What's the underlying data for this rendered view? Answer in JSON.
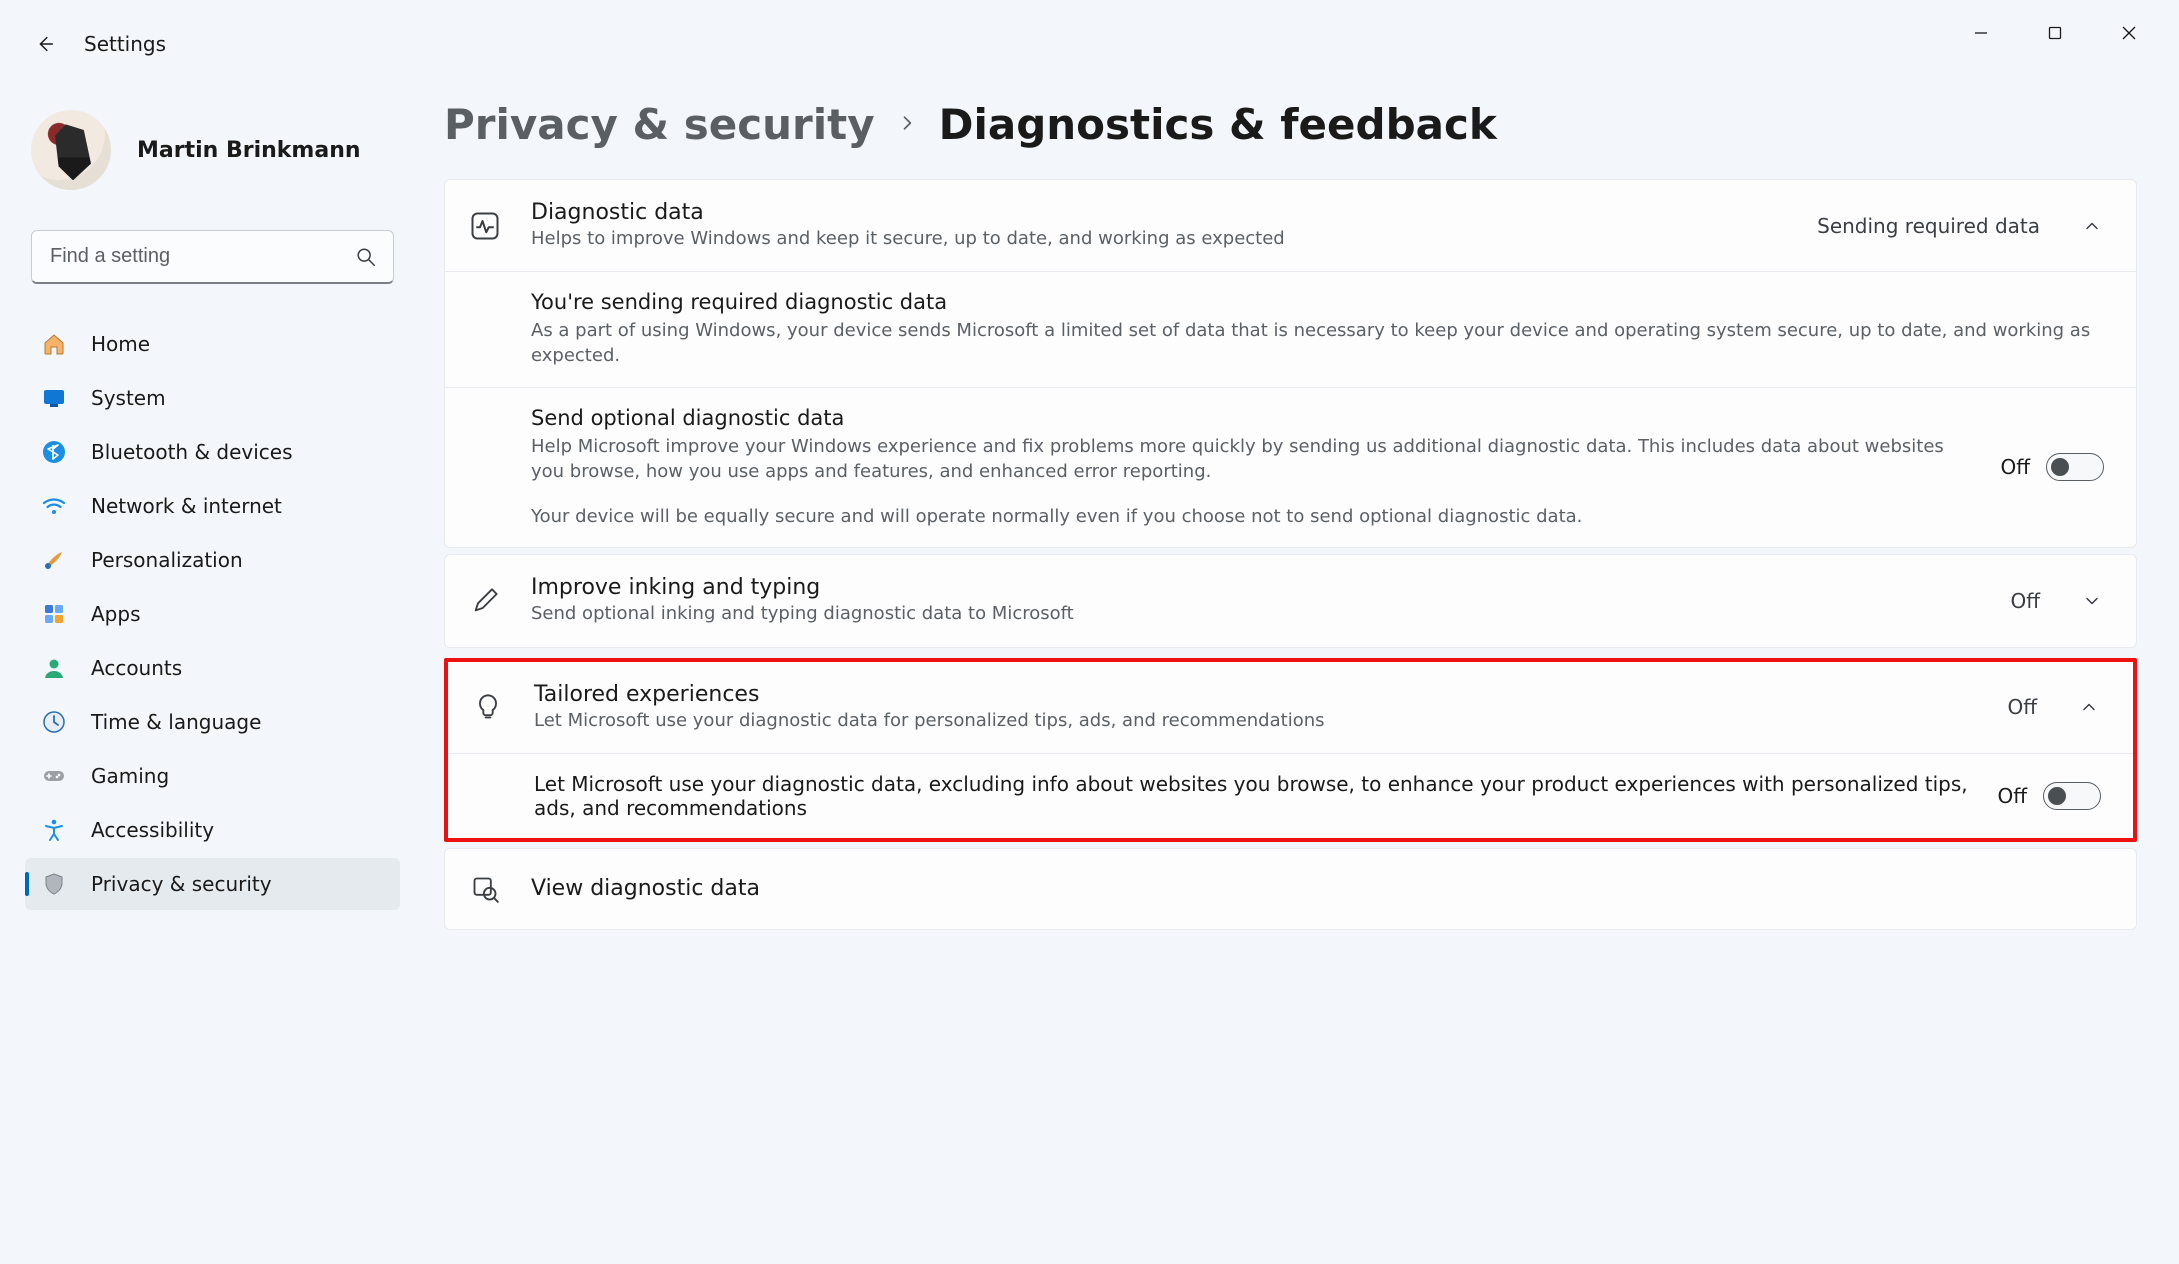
{
  "app_title": "Settings",
  "user_name": "Martin Brinkmann",
  "search": {
    "placeholder": "Find a setting"
  },
  "nav": {
    "items": [
      {
        "id": "home",
        "label": "Home"
      },
      {
        "id": "system",
        "label": "System"
      },
      {
        "id": "bluetooth",
        "label": "Bluetooth & devices"
      },
      {
        "id": "network",
        "label": "Network & internet"
      },
      {
        "id": "personalization",
        "label": "Personalization"
      },
      {
        "id": "apps",
        "label": "Apps"
      },
      {
        "id": "accounts",
        "label": "Accounts"
      },
      {
        "id": "time",
        "label": "Time & language"
      },
      {
        "id": "gaming",
        "label": "Gaming"
      },
      {
        "id": "accessibility",
        "label": "Accessibility"
      },
      {
        "id": "privacy",
        "label": "Privacy & security"
      }
    ]
  },
  "breadcrumb": {
    "parent": "Privacy & security",
    "current": "Diagnostics & feedback"
  },
  "sections": {
    "diag": {
      "title": "Diagnostic data",
      "sub": "Helps to improve Windows and keep it secure, up to date, and working as expected",
      "status": "Sending required data",
      "rows": [
        {
          "title": "You're sending required diagnostic data",
          "desc": "As a part of using Windows, your device sends Microsoft a limited set of data that is necessary to keep your device and operating system secure, up to date, and working as expected."
        },
        {
          "title": "Send optional diagnostic data",
          "desc": "Help Microsoft improve your Windows experience and fix problems more quickly by sending us additional diagnostic data. This includes data about websites you browse, how you use apps and features, and enhanced error reporting.",
          "desc2": "Your device will be equally secure and will operate normally even if you choose not to send optional diagnostic data.",
          "toggle": "Off"
        }
      ]
    },
    "inking": {
      "title": "Improve inking and typing",
      "sub": "Send optional inking and typing diagnostic data to Microsoft",
      "status": "Off"
    },
    "tailored": {
      "title": "Tailored experiences",
      "sub": "Let Microsoft use your diagnostic data for personalized tips, ads, and recommendations",
      "status": "Off",
      "row": {
        "desc": "Let Microsoft use your diagnostic data, excluding info about websites you browse, to enhance your product experiences with personalized tips, ads, and recommendations",
        "toggle": "Off"
      }
    },
    "view": {
      "title": "View diagnostic data"
    }
  }
}
